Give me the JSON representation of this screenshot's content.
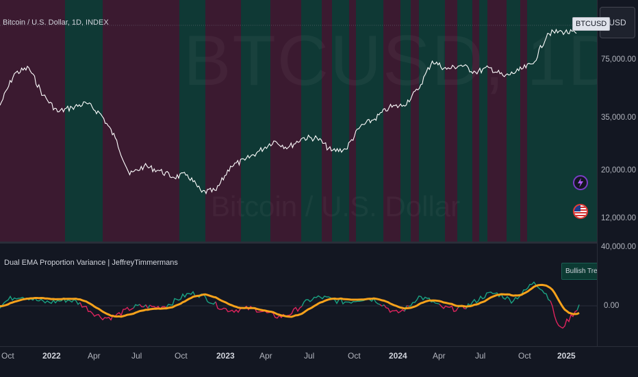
{
  "chart": {
    "legend_title": "Bitcoin / U.S. Dollar, 1D, INDEX",
    "watermark_big": "BTCUSD, 1D",
    "watermark_small": "Bitcoin / U.S. Dollar",
    "symbol_badge": "BTCUSD",
    "currency_button": "USD",
    "scale_type": "log",
    "background_regimes_note_colors": {
      "bull": "#0f3935",
      "bear": "#3b1a30"
    },
    "price_ticks": [
      "75,000.00",
      "35,000.00",
      "20,000.00",
      "12,000.00"
    ],
    "line_color": "#ffffff"
  },
  "indicator": {
    "title": "Dual EMA Proportion Variance | JeffreyTimmermans",
    "trend_label": "Bullish Trend",
    "ticks": [
      "40,000.00",
      "0.00"
    ],
    "colors": {
      "positive": "#1aa383",
      "negative": "#e0245e",
      "ema": "#f7a21b"
    }
  },
  "time_axis": {
    "labels": [
      {
        "text": "Oct",
        "year": false
      },
      {
        "text": "2022",
        "year": true
      },
      {
        "text": "Apr",
        "year": false
      },
      {
        "text": "Jul",
        "year": false
      },
      {
        "text": "Oct",
        "year": false
      },
      {
        "text": "2023",
        "year": true
      },
      {
        "text": "Apr",
        "year": false
      },
      {
        "text": "Jul",
        "year": false
      },
      {
        "text": "Oct",
        "year": false
      },
      {
        "text": "2024",
        "year": true
      },
      {
        "text": "Apr",
        "year": false
      },
      {
        "text": "Jul",
        "year": false
      },
      {
        "text": "Oct",
        "year": false
      },
      {
        "text": "2025",
        "year": true
      }
    ]
  },
  "chart_data": {
    "type": "line",
    "title": "Bitcoin / U.S. Dollar, 1D, INDEX",
    "series": [
      {
        "name": "BTCUSD",
        "x": [
          "2021-09",
          "2021-10",
          "2021-11",
          "2021-12",
          "2022-01",
          "2022-02",
          "2022-03",
          "2022-04",
          "2022-05",
          "2022-06",
          "2022-07",
          "2022-08",
          "2022-09",
          "2022-10",
          "2022-11",
          "2022-12",
          "2023-01",
          "2023-02",
          "2023-03",
          "2023-04",
          "2023-05",
          "2023-06",
          "2023-07",
          "2023-08",
          "2023-09",
          "2023-10",
          "2023-11",
          "2023-12",
          "2024-01",
          "2024-02",
          "2024-03",
          "2024-04",
          "2024-05",
          "2024-06",
          "2024-07",
          "2024-08",
          "2024-09",
          "2024-10",
          "2024-11",
          "2024-12",
          "2025-01"
        ],
        "values": [
          43000,
          61000,
          65000,
          48000,
          40000,
          42000,
          44000,
          39000,
          30000,
          20000,
          22000,
          21000,
          19500,
          20000,
          16500,
          16800,
          22000,
          23500,
          26000,
          29000,
          27000,
          30000,
          30000,
          26000,
          26500,
          34000,
          37000,
          42000,
          43000,
          51000,
          70000,
          64000,
          67000,
          62000,
          65000,
          59000,
          63000,
          68000,
          95000,
          97000,
          95000
        ]
      }
    ]
  }
}
